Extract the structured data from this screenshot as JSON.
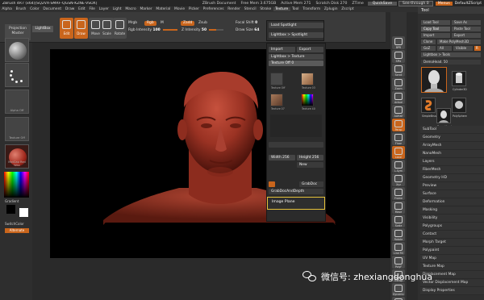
{
  "titlebar": {
    "title": "ZBrush 4R7 (x64)[SQ2VX-SMRF-QGSN-KZNE-VSOX]",
    "document": "ZBrush Document",
    "free_mem": "Free Mem 3.675GB",
    "active_mem": "Active Mem 271",
    "scratch_disk": "Scratch Disk 270",
    "ztime": "ZTime",
    "quicksave": "QuickSave",
    "see_through": "See-through 0",
    "menus": "Menus",
    "default_script": "DefaultZScript"
  },
  "menubar": {
    "items": [
      "Alpha",
      "Brush",
      "Color",
      "Document",
      "Draw",
      "Edit",
      "File",
      "Layer",
      "Light",
      "Macro",
      "Marker",
      "Material",
      "Movie",
      "Picker",
      "Preferences",
      "Render",
      "Stencil",
      "Stroke",
      "Texture",
      "Tool",
      "Transform",
      "Zplugin",
      "Zscript"
    ],
    "active": "Texture"
  },
  "toolbar": {
    "projection_master": "Projection Master",
    "lightbox": "LightBox",
    "buttons": [
      {
        "label": "Edit",
        "active": true
      },
      {
        "label": "Draw",
        "active": true
      },
      {
        "label": "Move",
        "active": false
      },
      {
        "label": "Scale",
        "active": false
      },
      {
        "label": "Rotate",
        "active": false
      }
    ],
    "mrgb": "Mrgb",
    "rgb": "Rgb",
    "m": "M",
    "rgb_intensity_label": "Rgb Intensity",
    "rgb_intensity_value": "100",
    "zadd": "Zadd",
    "zsub": "Zsub",
    "z_intensity_label": "Z Intensity",
    "z_intensity_value": "50",
    "focal_shift_label": "Focal Shift",
    "focal_shift_value": "0",
    "draw_size_label": "Draw Size",
    "draw_size_value": "64"
  },
  "leftpanel": {
    "tiles": [
      "Standard",
      "DragRect",
      "",
      "Alpha Off",
      "Texture Off",
      "MatCap Red Wax"
    ],
    "gradient": "Gradient",
    "switch_color": "SwitchColor",
    "alternate": "Alternate"
  },
  "texture_panel": {
    "load_spotlight": "Load Spotlight",
    "lightbox_spotlight": "Lightbox > Spotlight",
    "import": "Import",
    "export": "Export",
    "lightbox_texture": "Lightbox > Texture",
    "texture_off": "Texture Off",
    "texture_off_value": "0",
    "textures": [
      "Texture Off",
      "Texture 03",
      "Texture 07",
      "Texture 40"
    ],
    "width_label": "Width",
    "width_value": "256",
    "height_label": "Height",
    "height_value": "256",
    "new": "New",
    "grabdoc": "GrabDoc",
    "grabdoc_and_depth": "GrabDocAndDepth",
    "image_plane": "Image Plane"
  },
  "right_strip": {
    "items": [
      "BPR",
      "SPix",
      "Scroll",
      "Zoom",
      "Actual",
      "AAHalf",
      "Persp",
      "Floor",
      "Local",
      "L.Sym",
      "Xyz",
      "Frame",
      "Move",
      "Scale",
      "Rotate",
      "Line Fill",
      "PolyF",
      "Transp",
      "Dynamic",
      "Solo"
    ]
  },
  "tool_panel": {
    "title": "Tool",
    "load_tool": "Load Tool",
    "save_as": "Save As",
    "copy_tool": "Copy Tool",
    "paste_tool": "Paste Tool",
    "import": "Import",
    "export": "Export",
    "clone": "Clone",
    "make_polymesh3d": "Make PolyMesh3D",
    "goz": "GoZ",
    "all": "All",
    "visible": "Visible",
    "r": "R",
    "lightbox_tools": "Lightbox > Tools",
    "current_tool": "DemoHead. 50",
    "thumbs": [
      "DemoHead",
      "Cylinder3D",
      "SimpleBrush",
      "PolySphere",
      "DemoHead"
    ],
    "subpalettes": [
      "SubTool",
      "Geometry",
      "ArrayMesh",
      "NanoMesh",
      "Layers",
      "FiberMesh",
      "Geometry HD",
      "Preview",
      "Surface",
      "Deformation",
      "Masking",
      "Visibility",
      "Polygroups",
      "Contact",
      "Morph Target",
      "Polypaint",
      "UV Map",
      "Texture Map",
      "Displacement Map",
      "Vector Displacement Map",
      "Display Properties"
    ]
  },
  "watermark": {
    "text": "微信号: zhexiangdonghua"
  },
  "colors": {
    "accent": "#c9651c",
    "highlight": "#e6c23a",
    "clay": "#a8392a"
  }
}
